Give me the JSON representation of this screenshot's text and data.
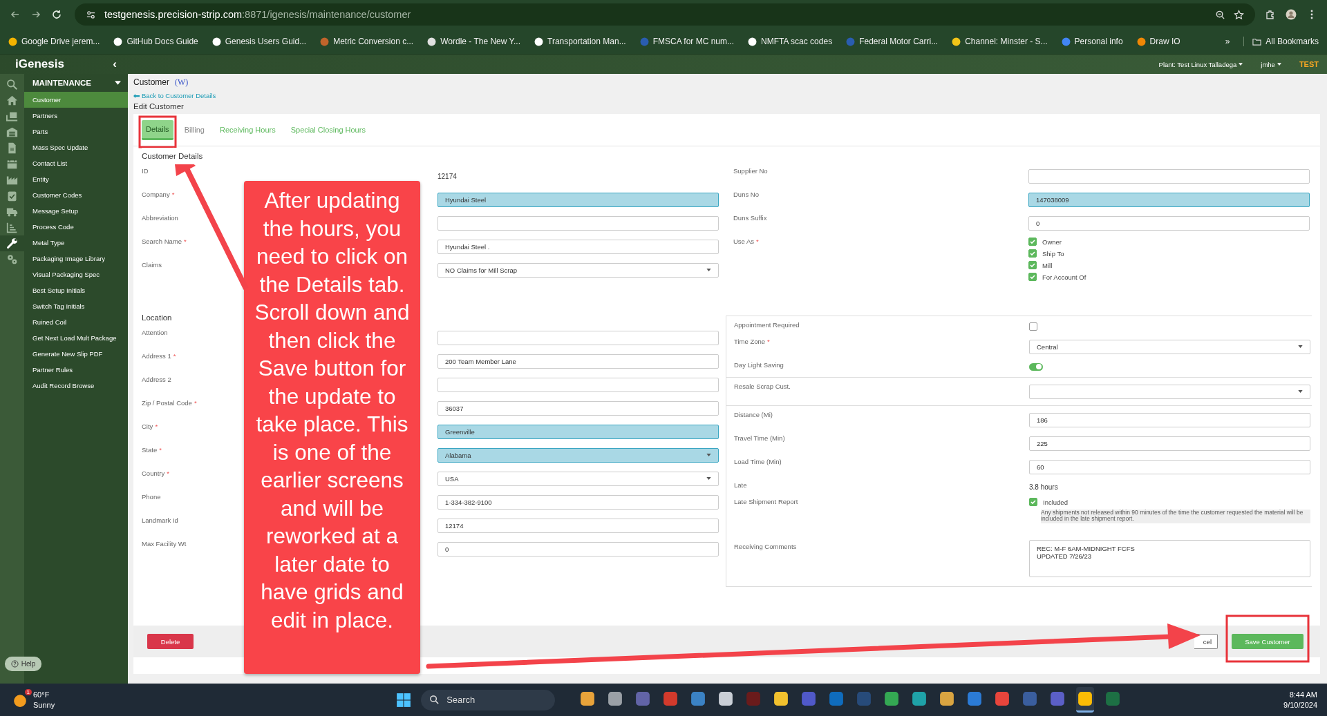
{
  "browser": {
    "url_host": "testgenesis.precision-strip.com",
    "url_path": ":8871/igenesis/maintenance/customer"
  },
  "bookmarks": [
    {
      "label": "Google Drive jerem...",
      "color": "#f4b400"
    },
    {
      "label": "GitHub Docs Guide",
      "color": "#ffffff"
    },
    {
      "label": "Genesis Users Guid...",
      "color": "#ffffff"
    },
    {
      "label": "Metric Conversion c...",
      "color": "#c0642b"
    },
    {
      "label": "Wordle - The New Y...",
      "color": "#e0e0e0"
    },
    {
      "label": "Transportation Man...",
      "color": "#ffffff"
    },
    {
      "label": "FMSCA for MC num...",
      "color": "#2a5db0"
    },
    {
      "label": "NMFTA scac codes",
      "color": "#ffffff"
    },
    {
      "label": "Federal Motor Carri...",
      "color": "#2a5db0"
    },
    {
      "label": "Channel: Minster - S...",
      "color": "#f2c418"
    },
    {
      "label": "Personal info",
      "color": "#4285f4"
    },
    {
      "label": "Draw IO",
      "color": "#f08705"
    }
  ],
  "more_bookmarks": "»",
  "all_bookmarks": "All Bookmarks",
  "app_header": {
    "logo": "iGenesis",
    "collapse": "‹",
    "plant": "Plant: Test Linux Talladega",
    "user": "jmhe",
    "env": "TEST"
  },
  "rail": [
    {
      "kind": "search",
      "selected": false
    },
    {
      "kind": "home",
      "selected": false
    },
    {
      "kind": "pallet",
      "selected": false
    },
    {
      "kind": "warehouse",
      "selected": false
    },
    {
      "kind": "document",
      "selected": false
    },
    {
      "kind": "calendar",
      "selected": false
    },
    {
      "kind": "factory",
      "selected": false
    },
    {
      "kind": "clipboard",
      "selected": false
    },
    {
      "kind": "truck",
      "selected": false
    },
    {
      "kind": "chart",
      "selected": false
    },
    {
      "kind": "wrench",
      "selected": true
    },
    {
      "kind": "gears",
      "selected": false
    }
  ],
  "menu": {
    "title": "MAINTENANCE",
    "items": [
      {
        "label": "Customer",
        "selected": true
      },
      {
        "label": "Partners",
        "selected": false
      },
      {
        "label": "Parts",
        "selected": false
      },
      {
        "label": "Mass Spec Update",
        "selected": false
      },
      {
        "label": "Contact List",
        "selected": false
      },
      {
        "label": "Entity",
        "selected": false
      },
      {
        "label": "Customer Codes",
        "selected": false
      },
      {
        "label": "Message Setup",
        "selected": false
      },
      {
        "label": "Process Code",
        "selected": false
      },
      {
        "label": "Metal Type",
        "selected": false
      },
      {
        "label": "Packaging Image Library",
        "selected": false
      },
      {
        "label": "Visual Packaging Spec",
        "selected": false
      },
      {
        "label": "Best Setup Initials",
        "selected": false
      },
      {
        "label": "Switch Tag Initials",
        "selected": false
      },
      {
        "label": "Ruined Coil",
        "selected": false
      },
      {
        "label": "Get Next Load Mult Package",
        "selected": false
      },
      {
        "label": "Generate New Slip PDF",
        "selected": false
      },
      {
        "label": "Partner Rules",
        "selected": false
      },
      {
        "label": "Audit Record Browse",
        "selected": false
      }
    ]
  },
  "help": "Help",
  "page": {
    "title": "Customer",
    "badge": "(W)",
    "back": "Back to Customer Details",
    "subtitle": "Edit Customer"
  },
  "tabs": [
    {
      "label": "Details",
      "selected": true,
      "disabled": false
    },
    {
      "label": "Billing",
      "selected": false,
      "disabled": true
    },
    {
      "label": "Receiving Hours",
      "selected": false,
      "disabled": false
    },
    {
      "label": "Special Closing Hours",
      "selected": false,
      "disabled": false
    }
  ],
  "left_sections": [
    {
      "title": "Customer Details",
      "fields": [
        {
          "label": "ID",
          "kind": "static",
          "value": "12174"
        },
        {
          "label": "Company",
          "mark": "*",
          "kind": "input",
          "value": "Hyundai Steel",
          "highlighted": true
        },
        {
          "label": "Abbreviation",
          "kind": "input",
          "highlighted": false
        },
        {
          "label": "Search Name",
          "mark": "*",
          "kind": "input",
          "value": "Hyundai Steel .",
          "highlighted": false
        },
        {
          "label": "Claims",
          "kind": "select",
          "value": "NO Claims for Mill Scrap",
          "highlighted": false
        }
      ]
    },
    {
      "title": "Location",
      "fields": [
        {
          "label": "Attention",
          "kind": "input",
          "highlighted": false
        },
        {
          "label": "Address 1",
          "mark": "*",
          "kind": "input",
          "value": "200 Team Member Lane",
          "highlighted": false
        },
        {
          "label": "Address 2",
          "kind": "input",
          "highlighted": false
        },
        {
          "label": "Zip / Postal Code",
          "mark": "*",
          "kind": "input",
          "value": "36037",
          "highlighted": false
        },
        {
          "label": "City",
          "mark": "*",
          "kind": "input",
          "value": "Greenville",
          "highlighted": true
        },
        {
          "label": "State",
          "mark": "*",
          "kind": "select",
          "value": "Alabama",
          "highlighted": true
        },
        {
          "label": "Country",
          "mark": "*",
          "kind": "select",
          "value": "USA",
          "highlighted": false
        },
        {
          "label": "Phone",
          "kind": "input",
          "value": "1-334-382-9100",
          "highlighted": false
        },
        {
          "label": "Landmark Id",
          "kind": "input",
          "value": "12174",
          "highlighted": false
        },
        {
          "label": "Max Facility Wt",
          "kind": "input",
          "value": "0",
          "highlighted": false
        }
      ]
    }
  ],
  "right_groups": [
    {
      "bordered": false,
      "fields": [
        {
          "label": "Supplier No",
          "kind": "input",
          "highlighted": false
        },
        {
          "label": "Duns No",
          "kind": "input",
          "value": "147038009",
          "highlighted": true
        },
        {
          "label": "Duns Suffix",
          "kind": "input",
          "value": "0",
          "highlighted": false
        },
        {
          "label": "Use As",
          "mark": "*",
          "kind": "checks",
          "items": [
            {
              "label": "Owner",
              "checked": true
            },
            {
              "label": "Ship To",
              "checked": true
            },
            {
              "label": "Mill",
              "checked": true
            },
            {
              "label": "For Account Of",
              "checked": true
            }
          ]
        }
      ]
    },
    {
      "bordered": true,
      "fields": [
        {
          "label": "Appointment Required",
          "kind": "checkbox",
          "checked": false
        },
        {
          "label": "Time Zone",
          "mark": "*",
          "kind": "select",
          "value": "Central",
          "highlighted": false
        },
        {
          "label": "Day Light Saving",
          "kind": "toggle",
          "on": true
        }
      ]
    },
    {
      "bordered": true,
      "fields": [
        {
          "label": "Resale Scrap Cust.",
          "kind": "select",
          "highlighted": false
        }
      ]
    },
    {
      "bordered": true,
      "fields": [
        {
          "label": "Distance (Mi)",
          "kind": "input",
          "value": "186",
          "highlighted": false
        },
        {
          "label": "Travel Time (Min)",
          "kind": "input",
          "value": "225",
          "highlighted": false
        },
        {
          "label": "Load Time (Min)",
          "kind": "input",
          "value": "60",
          "highlighted": false
        },
        {
          "label": "Late",
          "kind": "static",
          "value": "3.8 hours"
        },
        {
          "label": "Late Shipment Report",
          "kind": "check_note",
          "checked": true,
          "value": "Included",
          "note": "Any shipments not released within 90 minutes of the time the customer requested the material will be included in the late shipment report."
        },
        {
          "label": "Receiving Comments",
          "kind": "textarea",
          "lines": [
            "REC: M-F 6AM-MIDNIGHT FCFS",
            "UPDATED 7/26/23"
          ]
        }
      ]
    }
  ],
  "actions": {
    "delete": "Delete",
    "cancel": "cel",
    "save": "Save Customer"
  },
  "callout": "After updating the hours, you need to click on the Details tab. Scroll down and then click the Save button for the update to take place. This is one of the earlier screens and will be reworked at a later date to have grids and edit in place.",
  "taskbar": {
    "badge": "1",
    "temp": "60°F",
    "weather": "Sunny",
    "search": "Search",
    "time": "8:44 AM",
    "date": "9/10/2024",
    "apps": [
      {
        "color": "#e8a33a",
        "selected": false
      },
      {
        "color": "#9aa0a6",
        "selected": false
      },
      {
        "color": "#6264a7",
        "selected": false
      },
      {
        "color": "#d33a2c",
        "selected": false
      },
      {
        "color": "#3b82c4",
        "selected": false
      },
      {
        "color": "#c9ced6",
        "selected": false
      },
      {
        "color": "#6a1b1b",
        "selected": false
      },
      {
        "color": "#f2c12e",
        "selected": false
      },
      {
        "color": "#5059c9",
        "selected": false
      },
      {
        "color": "#0f6cbd",
        "selected": false
      },
      {
        "color": "#274b7a",
        "selected": false
      },
      {
        "color": "#34a853",
        "selected": false
      },
      {
        "color": "#1fa2a8",
        "selected": false
      },
      {
        "color": "#d9a441",
        "selected": false
      },
      {
        "color": "#2b7bd6",
        "selected": false
      },
      {
        "color": "#e8453c",
        "selected": false
      },
      {
        "color": "#3a5e9e",
        "selected": false
      },
      {
        "color": "#5b5fc7",
        "selected": false
      },
      {
        "color": "#fbbc05",
        "selected": true
      },
      {
        "color": "#1d7044",
        "selected": false
      }
    ]
  }
}
